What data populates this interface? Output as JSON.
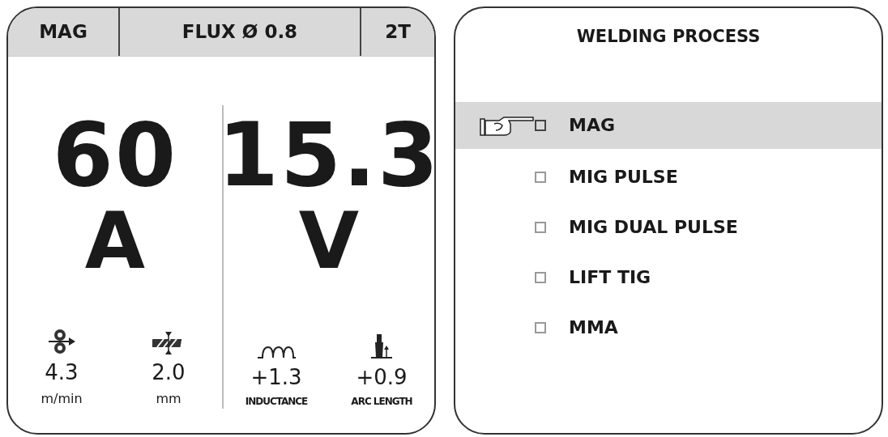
{
  "left_panel": {
    "header": [
      {
        "text": "MAG"
      },
      {
        "text": "FLUX Ø 0.8"
      },
      {
        "text": "2T"
      }
    ],
    "readings": [
      {
        "value": "60",
        "unit": "A"
      },
      {
        "value": "15.3",
        "unit": "V"
      }
    ],
    "parameters": [
      {
        "kind": "wire-speed",
        "value": "4.3",
        "unit": "m/min"
      },
      {
        "kind": "wire-diameter",
        "value": "2.0",
        "unit": "mm"
      },
      {
        "kind": "inductance",
        "value": "+1.3",
        "unit": "INDUCTANCE"
      },
      {
        "kind": "arc-length",
        "value": "+0.9",
        "unit": "ARC LENGTH"
      }
    ]
  },
  "right_panel": {
    "title": "WELDING PROCESS",
    "items": [
      {
        "label": "MAG",
        "selected": true
      },
      {
        "label": "MIG PULSE",
        "selected": false
      },
      {
        "label": "MIG DUAL PULSE",
        "selected": false
      },
      {
        "label": "LIFT TIG",
        "selected": false
      },
      {
        "label": "MMA",
        "selected": false
      }
    ]
  }
}
